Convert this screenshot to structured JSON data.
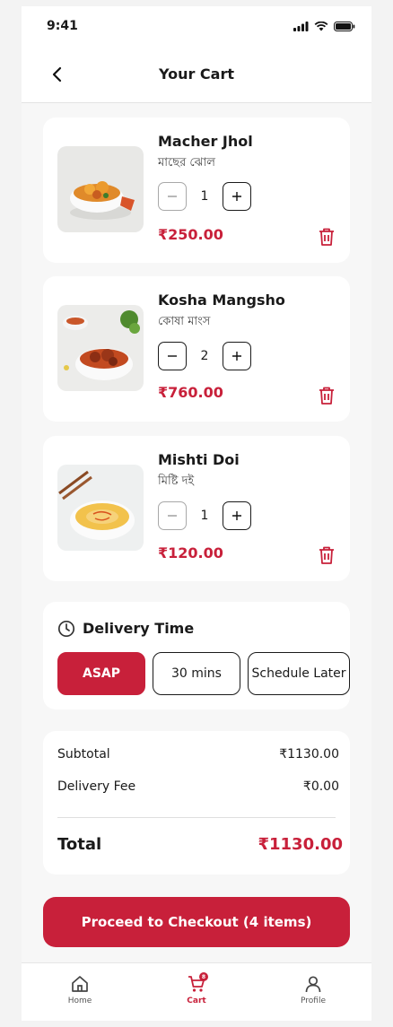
{
  "status_bar": {
    "time": "9:41"
  },
  "header": {
    "title": "Your Cart"
  },
  "cart_items": [
    {
      "name": "Macher Jhol",
      "native_name": "মাছের ঝোল",
      "quantity": "1",
      "price": "₹250.00"
    },
    {
      "name": "Kosha Mangsho",
      "native_name": "কোষা মাংস",
      "quantity": "2",
      "price": "₹760.00"
    },
    {
      "name": "Mishti Doi",
      "native_name": "মিষ্টি দই",
      "quantity": "1",
      "price": "₹120.00"
    }
  ],
  "delivery": {
    "title": "Delivery Time",
    "options": [
      "ASAP",
      "30 mins",
      "Schedule Later"
    ],
    "selected": "ASAP"
  },
  "summary": {
    "subtotal_label": "Subtotal",
    "subtotal_value": "₹1130.00",
    "fee_label": "Delivery Fee",
    "fee_value": "₹0.00",
    "total_label": "Total",
    "total_value": "₹1130.00"
  },
  "checkout": {
    "label": "Proceed to Checkout (4 items)"
  },
  "tabbar": {
    "items": [
      {
        "label": "Home",
        "icon": "home-icon"
      },
      {
        "label": "Cart",
        "icon": "cart-icon",
        "badge": "8"
      },
      {
        "label": "Profile",
        "icon": "user-icon"
      }
    ]
  },
  "colors": {
    "accent": "#c8203a",
    "background": "#f7f7f7",
    "card": "#ffffff"
  }
}
